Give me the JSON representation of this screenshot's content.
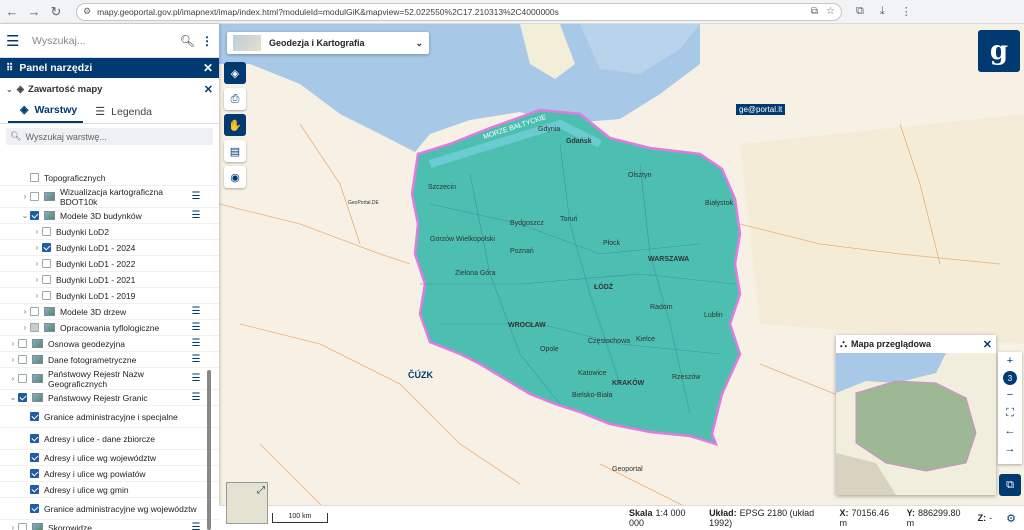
{
  "browser": {
    "url": "mapy.geoportal.gov.pl/imapnext/imap/index.html?moduleId=modulGiK&mapview=52.022550%2C17.210313%2C4000000s",
    "back_icon": "back-arrow-icon",
    "forward_icon": "forward-arrow-icon",
    "reload_icon": "reload-icon"
  },
  "search": {
    "placeholder": "Wyszukaj..."
  },
  "panel": {
    "title": "Panel narzędzi",
    "content_title": "Zawartość mapy",
    "tabs": [
      {
        "label": "Warstwy"
      },
      {
        "label": "Legenda"
      }
    ],
    "layer_search_placeholder": "Wyszukaj warstwę..."
  },
  "tree": [
    {
      "label": "Topograficznych",
      "indent": 2,
      "checked": "off",
      "thumb": false,
      "chevron": "",
      "menu": false
    },
    {
      "label": "Wizualizacja kartograficzna BDOT10k",
      "indent": 2,
      "checked": "off",
      "thumb": true,
      "chevron": ">",
      "menu": true
    },
    {
      "label": "Modele 3D budynków",
      "indent": 2,
      "checked": "on",
      "thumb": true,
      "chevron": "v",
      "menu": true
    },
    {
      "label": "Budynki LoD2",
      "indent": 3,
      "checked": "off",
      "thumb": false,
      "chevron": ">",
      "menu": false
    },
    {
      "label": "Budynki LoD1 - 2024",
      "indent": 3,
      "checked": "on",
      "thumb": false,
      "chevron": ">",
      "menu": false
    },
    {
      "label": "Budynki LoD1 - 2022",
      "indent": 3,
      "checked": "off",
      "thumb": false,
      "chevron": ">",
      "menu": false
    },
    {
      "label": "Budynki LoD1 - 2021",
      "indent": 3,
      "checked": "off",
      "thumb": false,
      "chevron": ">",
      "menu": false
    },
    {
      "label": "Budynki LoD1 - 2019",
      "indent": 3,
      "checked": "off",
      "thumb": false,
      "chevron": ">",
      "menu": false
    },
    {
      "label": "Modele 3D drzew",
      "indent": 2,
      "checked": "off",
      "thumb": true,
      "chevron": ">",
      "menu": true
    },
    {
      "label": "Opracowania tyflologiczne",
      "indent": 2,
      "checked": "partial",
      "thumb": true,
      "chevron": ">",
      "menu": true
    },
    {
      "label": "Osnowa geodezyjna",
      "indent": 1,
      "checked": "off",
      "thumb": true,
      "chevron": ">",
      "menu": true
    },
    {
      "label": "Dane fotogrametryczne",
      "indent": 1,
      "checked": "off",
      "thumb": true,
      "chevron": ">",
      "menu": true
    },
    {
      "label": "Państwowy Rejestr Nazw Geograficznych",
      "indent": 1,
      "checked": "off",
      "thumb": true,
      "chevron": ">",
      "menu": true
    },
    {
      "label": "Państwowy Rejestr Granic",
      "indent": 1,
      "checked": "on",
      "thumb": true,
      "chevron": "v",
      "menu": true
    },
    {
      "label": "Granice administracyjne i specjalne",
      "indent": 2,
      "checked": "on",
      "thumb": false,
      "chevron": "",
      "menu": false
    },
    {
      "label": "Adresy i ulice - dane zbiorcze",
      "indent": 2,
      "checked": "on",
      "thumb": false,
      "chevron": "",
      "menu": false
    },
    {
      "label": "Adresy i ulice wg województw",
      "indent": 2,
      "checked": "on",
      "thumb": false,
      "chevron": "",
      "menu": false
    },
    {
      "label": "Adresy i ulice wg powiatów",
      "indent": 2,
      "checked": "on",
      "thumb": false,
      "chevron": "",
      "menu": false
    },
    {
      "label": "Adresy i ulice wg gmin",
      "indent": 2,
      "checked": "on",
      "thumb": false,
      "chevron": "",
      "menu": false
    },
    {
      "label": "Granice administracyjne wg województw",
      "indent": 2,
      "checked": "on",
      "thumb": false,
      "chevron": "",
      "menu": false
    },
    {
      "label": "Skorowidze",
      "indent": 1,
      "checked": "off",
      "thumb": true,
      "chevron": ">",
      "menu": true
    },
    {
      "label": "Dane Archiwalne",
      "indent": 1,
      "checked": "off",
      "thumb": true,
      "chevron": ">",
      "menu": true
    }
  ],
  "theme": {
    "label": "Geodezja i Kartografia"
  },
  "overview": {
    "title": "Mapa przeglądowa"
  },
  "zoom": {
    "level": "3"
  },
  "map_labels": {
    "sea": "MORZE BAŁTYCKIE",
    "gdansk": "Gdańsk",
    "gdynia": "Gdynia",
    "szczecin": "Szczecin",
    "bydgoszcz": "Bydgoszcz",
    "torun": "Toruń",
    "olsztyn": "Olsztyn",
    "bialystok": "Białystok",
    "poznan": "Poznań",
    "warszawa": "WARSZAWA",
    "lodz": "ŁÓDŹ",
    "wroclaw": "WROCŁAW",
    "krakow": "KRAKÓW",
    "lublin": "Lublin",
    "radom": "Radom",
    "kielce": "Kielce",
    "katowice": "Katowice",
    "opole": "Opole",
    "rzeszow": "Rzeszów",
    "plock": "Płock",
    "zielona_gora": "Zielona Góra",
    "gorzow": "Gorzów Wielkopolski",
    "czestochowa": "Częstochowa",
    "bielsko": "Bielsko-Biała",
    "lt_badge": "ge@portal.lt",
    "cuzk": "ČÚZK",
    "geoportal_sk": "Geoportal",
    "geoportal_de": "GeoPortal.DE",
    "scale": "100 km"
  },
  "status": {
    "scale_label": "Skala",
    "scale_value": "1:4 000 000",
    "system_label": "Układ:",
    "system_value": "EPSG 2180 (układ 1992)",
    "x_label": "X:",
    "x_value": "70156.46 m",
    "y_label": "Y:",
    "y_value": "886299.80 m",
    "z_label": "Z:",
    "z_value": "-"
  },
  "colors": {
    "brand": "#003a70",
    "poland_fill": "#4dbfb0",
    "border": "#e07be0",
    "water": "#a8c8e8",
    "land": "#f6f1e4"
  }
}
